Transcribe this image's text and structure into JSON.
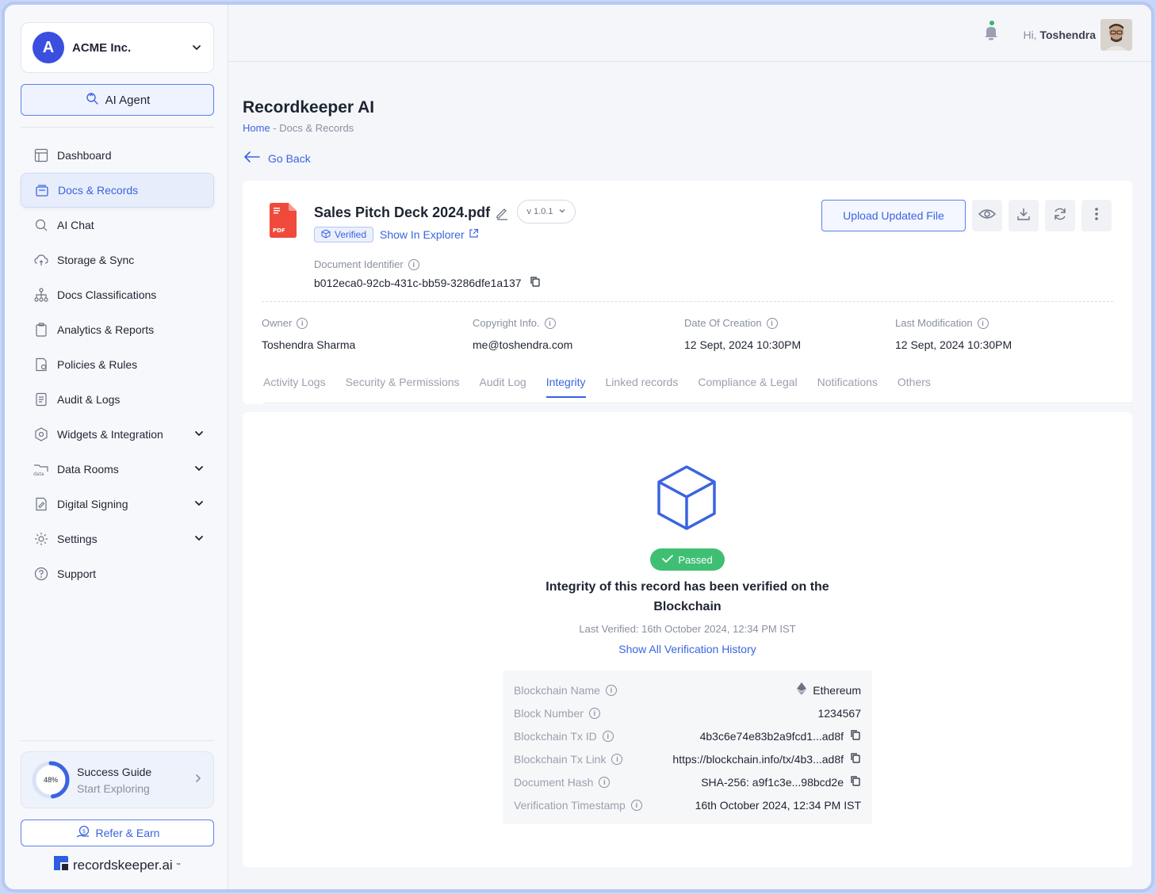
{
  "org": {
    "name": "ACME Inc.",
    "logo_letter": "A"
  },
  "ai_agent": {
    "label": "AI Agent"
  },
  "sidebar": {
    "items": [
      {
        "label": "Dashboard",
        "icon": "dashboard-icon",
        "active": false,
        "expandable": false
      },
      {
        "label": "Docs & Records",
        "icon": "docs-icon",
        "active": true,
        "expandable": false
      },
      {
        "label": "AI Chat",
        "icon": "ai-chat-icon",
        "active": false,
        "expandable": false
      },
      {
        "label": "Storage & Sync",
        "icon": "cloud-sync-icon",
        "active": false,
        "expandable": false
      },
      {
        "label": "Docs Classifications",
        "icon": "hierarchy-icon",
        "active": false,
        "expandable": false
      },
      {
        "label": "Analytics & Reports",
        "icon": "clipboard-icon",
        "active": false,
        "expandable": false
      },
      {
        "label": "Policies & Rules",
        "icon": "policy-icon",
        "active": false,
        "expandable": false
      },
      {
        "label": "Audit & Logs",
        "icon": "log-icon",
        "active": false,
        "expandable": false
      },
      {
        "label": "Widgets & Integration",
        "icon": "widgets-icon",
        "active": false,
        "expandable": true
      },
      {
        "label": "Data Rooms",
        "icon": "data-room-icon",
        "active": false,
        "expandable": true
      },
      {
        "label": "Digital Signing",
        "icon": "signing-icon",
        "active": false,
        "expandable": true
      },
      {
        "label": "Settings",
        "icon": "gear-icon",
        "active": false,
        "expandable": true
      },
      {
        "label": "Support",
        "icon": "help-icon",
        "active": false,
        "expandable": false
      }
    ]
  },
  "guide": {
    "progress_label": "48%",
    "progress": 0.48,
    "title": "Success Guide",
    "subtitle": "Start Exploring"
  },
  "refer": {
    "label": "Refer & Earn"
  },
  "brand": {
    "name": "recordskeeper.ai",
    "tm": "™"
  },
  "topbar": {
    "greeting_prefix": "Hi,",
    "user_name": "Toshendra"
  },
  "page": {
    "title": "Recordkeeper AI",
    "breadcrumb_home": "Home",
    "breadcrumb_sep": " - ",
    "breadcrumb_current": "Docs & Records",
    "go_back": "Go Back"
  },
  "doc": {
    "name": "Sales Pitch Deck 2024.pdf",
    "version": "v 1.0.1",
    "file_type": "PDF",
    "verified_label": "Verified",
    "explorer_label": "Show In Explorer",
    "identifier_label": "Document Identifier",
    "identifier": "b012eca0-92cb-431c-bb59-3286dfe1a137",
    "upload_label": "Upload Updated File",
    "meta": [
      {
        "label": "Owner",
        "value": "Toshendra Sharma"
      },
      {
        "label": "Copyright Info.",
        "value": "me@toshendra.com"
      },
      {
        "label": "Date Of Creation",
        "value": "12 Sept, 2024 10:30PM"
      },
      {
        "label": "Last Modification",
        "value": "12 Sept, 2024 10:30PM"
      }
    ],
    "tabs": [
      {
        "label": "Activity Logs",
        "active": false
      },
      {
        "label": "Security & Permissions",
        "active": false
      },
      {
        "label": "Audit Log",
        "active": false
      },
      {
        "label": "Integrity",
        "active": true
      },
      {
        "label": "Linked records",
        "active": false
      },
      {
        "label": "Compliance & Legal",
        "active": false
      },
      {
        "label": "Notifications",
        "active": false
      },
      {
        "label": "Others",
        "active": false
      }
    ]
  },
  "integrity": {
    "status": "Passed",
    "title": "Integrity of this record has been verified on the Blockchain",
    "last_verified": "Last Verified: 16th October 2024, 12:34 PM IST",
    "history_link": "Show All Verification History",
    "rows": [
      {
        "label": "Blockchain Name",
        "value": "Ethereum",
        "copy": false
      },
      {
        "label": "Block Number",
        "value": "1234567",
        "copy": false
      },
      {
        "label": "Blockchain Tx ID",
        "value": "4b3c6e74e83b2a9fcd1...ad8f",
        "copy": true
      },
      {
        "label": "Blockchain Tx Link",
        "value": "https://blockchain.info/tx/4b3...ad8f",
        "copy": true
      },
      {
        "label": "Document Hash",
        "value": "SHA-256: a9f1c3e...98bcd2e",
        "copy": true
      },
      {
        "label": "Verification Timestamp",
        "value": "16th October 2024, 12:34 PM IST",
        "copy": false
      }
    ]
  },
  "colors": {
    "accent": "#3a64e0",
    "success": "#3fbf74",
    "brand": "#3a4fe0"
  }
}
